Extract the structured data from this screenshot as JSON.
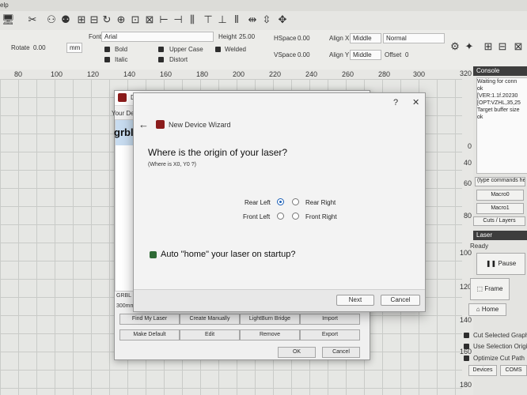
{
  "menubar": {
    "fragment": "elp"
  },
  "textbar": {
    "rotate_label": "Rotate",
    "rotate_value": "0.00",
    "unit_button": "mm",
    "font_label": "Font",
    "font_value": "Arial",
    "height_label": "Height",
    "height_value": "25.00",
    "hspace_label": "HSpace",
    "hspace_value": "0.00",
    "vspace_label": "VSpace",
    "vspace_value": "0.00",
    "alignx_label": "Align X",
    "alignx_value": "Middle",
    "aligny_label": "Align Y",
    "aligny_value": "Middle",
    "style_value": "Normal",
    "offset_label": "Offset",
    "offset_value": "0",
    "bold": "Bold",
    "italic": "Italic",
    "upper_case": "Upper Case",
    "distort": "Distort",
    "welded": "Welded"
  },
  "hruler": [
    "80",
    "100",
    "120",
    "140",
    "160",
    "180",
    "200",
    "220",
    "240",
    "260",
    "280",
    "300"
  ],
  "vruler": [
    "320",
    "0",
    "40",
    "60",
    "80",
    "100",
    "120",
    "140",
    "160",
    "180"
  ],
  "console": {
    "title": "Console",
    "lines": [
      "Waiting for conn",
      "ok",
      "[VER:1.1f.20230",
      "[OPT:VZHL,35,25",
      "Target buffer size",
      "ok"
    ],
    "input_placeholder": "(type commands he",
    "macro0": "Macro0",
    "macro1": "Macro1",
    "tab": "Cuts / Layers"
  },
  "laser": {
    "title": "Laser",
    "status": "Ready",
    "pause": "Pause",
    "frame": "Frame",
    "home": "Home",
    "cut_selected": "Cut Selected Graphic",
    "use_selection": "Use Selection Origin",
    "optimize": "Optimize Cut Path",
    "devices": "Devices",
    "coms": "COMS"
  },
  "devices_dialog": {
    "title": "De",
    "list_label": "Your Devi",
    "device_logo": "grbl",
    "device_name": "GRBL - S",
    "device_size": "300mm",
    "buttons": [
      "Find My Laser",
      "Create Manually",
      "LightBurn Bridge",
      "Import",
      "Make Default",
      "Edit",
      "Remove",
      "Export"
    ],
    "ok": "OK",
    "cancel": "Cancel"
  },
  "wizard": {
    "title": "New Device Wizard",
    "help": "?",
    "close": "✕",
    "heading": "Where is the origin of your laser?",
    "subheading": "(Where is X0, Y0 ?)",
    "options": {
      "rear_left": "Rear Left",
      "rear_right": "Rear Right",
      "front_left": "Front Left",
      "front_right": "Front Right"
    },
    "selected": "rear_left",
    "auto_home": "Auto \"home\" your laser on startup?",
    "auto_home_checked": true,
    "next": "Next",
    "cancel": "Cancel"
  }
}
